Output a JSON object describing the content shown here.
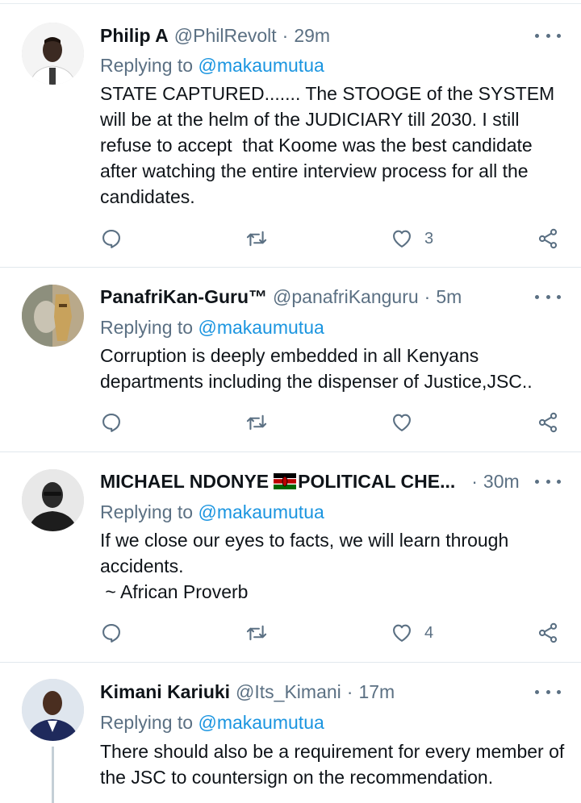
{
  "reply_prefix": "Replying to ",
  "tweets": [
    {
      "name": "Philip A",
      "handle": "@PhilRevolt",
      "time": "29m",
      "replying_to": "@makaumutua",
      "text": "STATE CAPTURED....... The STOOGE of the SYSTEM will be at the helm of the JUDICIARY till 2030. I still refuse to accept  that Koome was the best candidate after watching the entire interview process for all the candidates.",
      "likes": "3"
    },
    {
      "name": "PanafriKan-Guru™",
      "handle": "@panafriKanguru",
      "time": "5m",
      "replying_to": "@makaumutua",
      "text": "Corruption is deeply embedded in all Kenyans departments including the dispenser of Justice,JSC..",
      "likes": ""
    },
    {
      "name_part1": "MICHAEL NDONYE",
      "name_part2": "POLITICAL CHE...",
      "flag_icon": "kenya-flag-icon",
      "time": "30m",
      "replying_to": "@makaumutua",
      "text": "If we close our eyes to facts, we will learn through accidents.\n ~ African Proverb",
      "likes": "4"
    },
    {
      "name": "Kimani Kariuki",
      "handle": "@Its_Kimani",
      "time": "17m",
      "replying_to": "@makaumutua",
      "text": "There should also be a requirement for every member of the JSC to countersign on the recommendation."
    }
  ],
  "dot_separator": "·",
  "colors": {
    "text": "#0f1419",
    "secondary": "#5b7083",
    "mention": "#1b95e0",
    "divider": "#e1e8ed"
  },
  "icons": [
    "reply-icon",
    "retweet-icon",
    "like-icon",
    "share-icon",
    "more-options-icon"
  ]
}
